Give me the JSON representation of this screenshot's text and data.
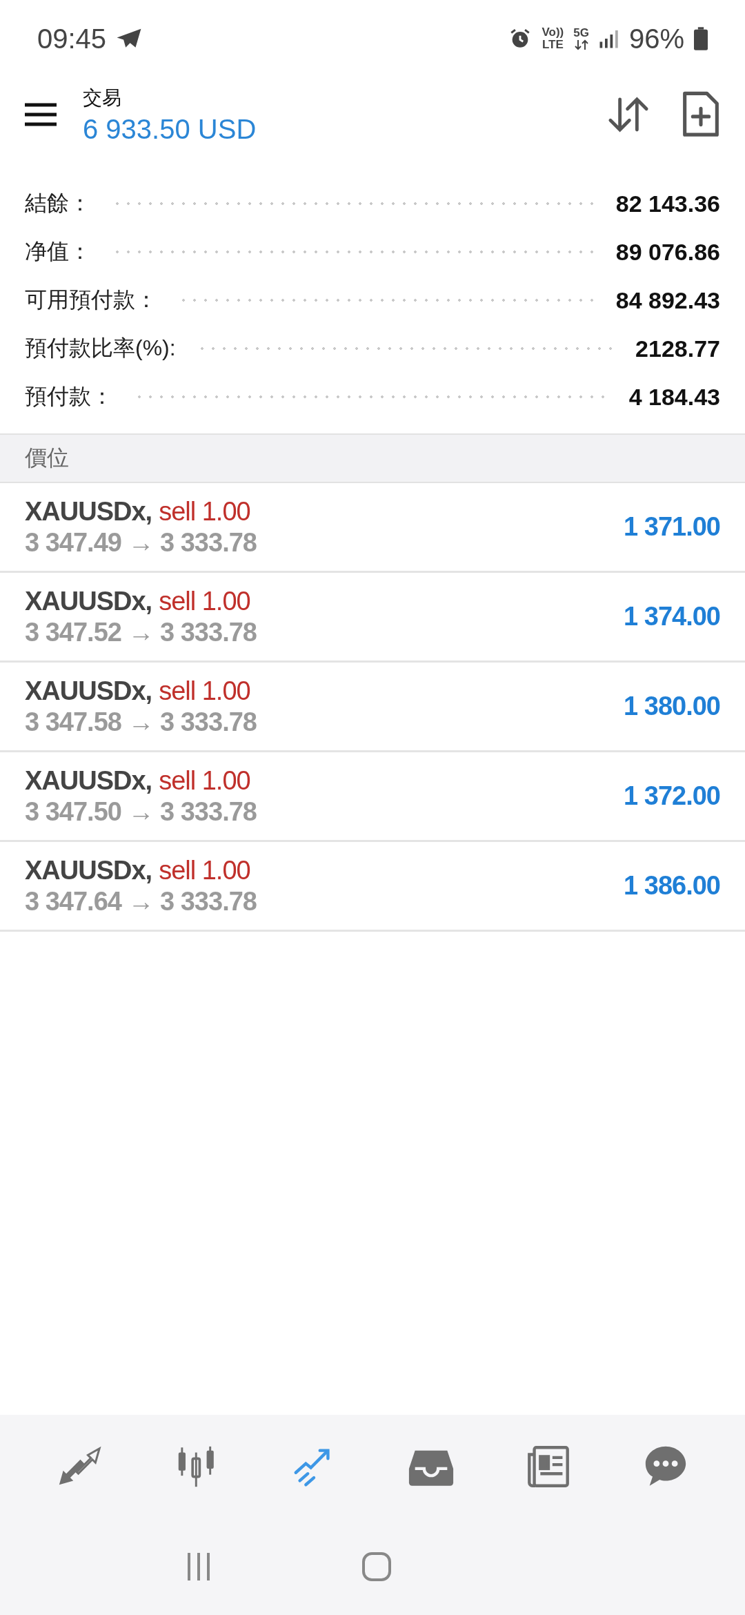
{
  "status_bar": {
    "time": "09:45",
    "volte": "Vo))",
    "lte": "LTE",
    "network": "5G",
    "battery": "96%"
  },
  "header": {
    "title": "交易",
    "balance": "6 933.50 USD"
  },
  "summary": [
    {
      "label": "結餘：",
      "value": "82 143.36"
    },
    {
      "label": "净值：",
      "value": "89 076.86"
    },
    {
      "label": "可用預付款：",
      "value": "84 892.43"
    },
    {
      "label": "預付款比率(%):",
      "value": "2128.77"
    },
    {
      "label": "預付款：",
      "value": "4 184.43"
    }
  ],
  "section": {
    "title": "價位"
  },
  "positions": [
    {
      "symbol": "XAUUSDx,",
      "order": "sell 1.00",
      "prices": "3 347.49 → 3 333.78",
      "profit": "1 371.00"
    },
    {
      "symbol": "XAUUSDx,",
      "order": "sell 1.00",
      "prices": "3 347.52 → 3 333.78",
      "profit": "1 374.00"
    },
    {
      "symbol": "XAUUSDx,",
      "order": "sell 1.00",
      "prices": "3 347.58 → 3 333.78",
      "profit": "1 380.00"
    },
    {
      "symbol": "XAUUSDx,",
      "order": "sell 1.00",
      "prices": "3 347.50 → 3 333.78",
      "profit": "1 372.00"
    },
    {
      "symbol": "XAUUSDx,",
      "order": "sell 1.00",
      "prices": "3 347.64 → 3 333.78",
      "profit": "1 386.00"
    }
  ],
  "bottom_nav": [
    {
      "kind": "quotes",
      "selected": false
    },
    {
      "kind": "chart",
      "selected": false
    },
    {
      "kind": "trade",
      "selected": true
    },
    {
      "kind": "history",
      "selected": false
    },
    {
      "kind": "news",
      "selected": false
    },
    {
      "kind": "chat",
      "selected": false
    }
  ]
}
